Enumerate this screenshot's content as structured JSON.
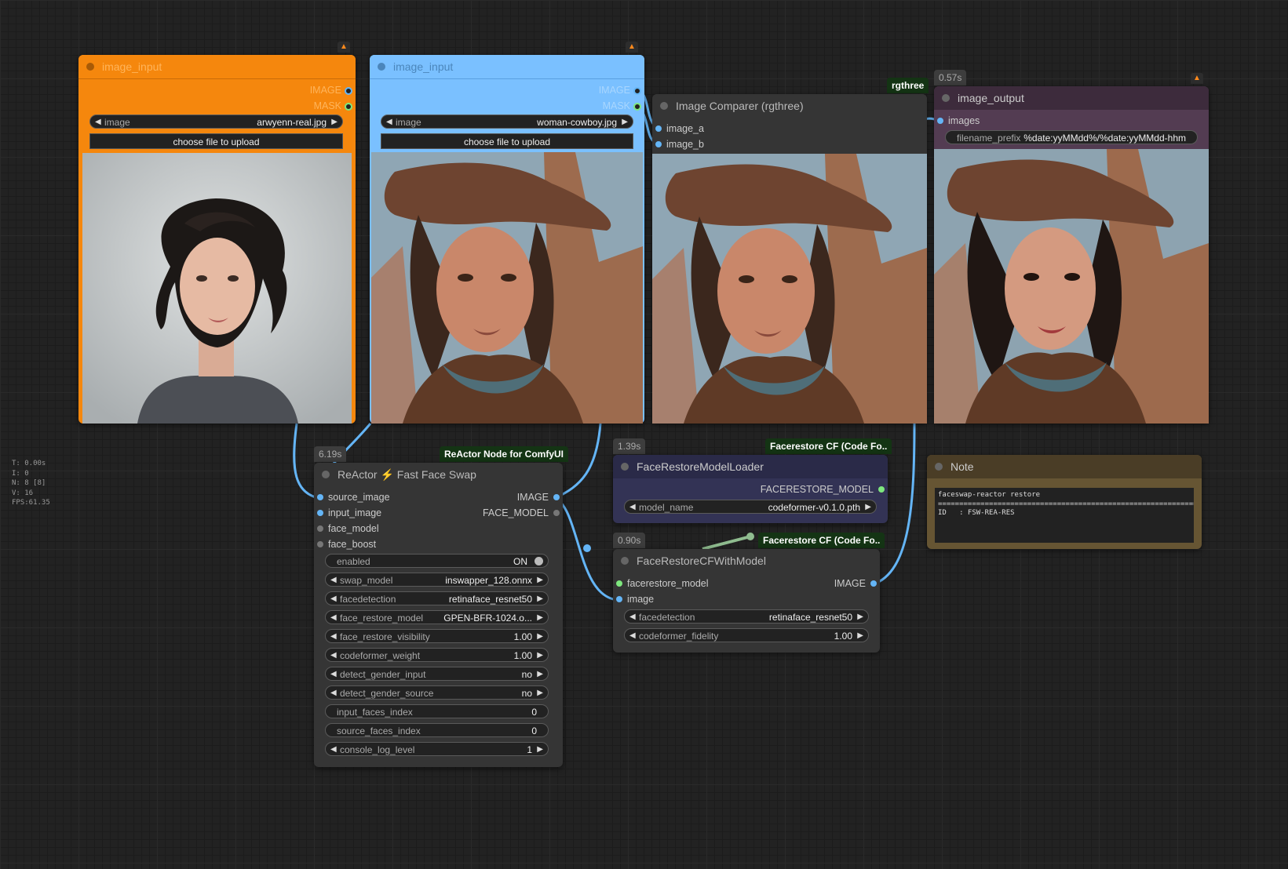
{
  "stats": {
    "lines": [
      "T: 0.00s",
      "I: 0",
      "N: 8 [8]",
      "V: 16",
      "FPS:61.35"
    ]
  },
  "colors": {
    "link_image": "#64b5f6",
    "link_model": "#8fbc8f",
    "canvas_bg": "#222222"
  },
  "nodes": {
    "image_input_1": {
      "title": "image_input",
      "color": "#f5870d",
      "outputs": [
        "IMAGE",
        "MASK"
      ],
      "image_widget": {
        "label": "image",
        "value": "arwyenn-real.jpg"
      },
      "upload_label": "choose file to upload",
      "badge_icon": "fox-icon"
    },
    "image_input_2": {
      "title": "image_input",
      "color": "#7ac0ff",
      "outputs": [
        "IMAGE",
        "MASK"
      ],
      "image_widget": {
        "label": "image",
        "value": "woman-cowboy.jpg"
      },
      "upload_label": "choose file to upload",
      "badge_icon": "fox-icon"
    },
    "image_comparer": {
      "title": "Image Comparer (rgthree)",
      "pack": "rgthree",
      "inputs": [
        "image_a",
        "image_b"
      ]
    },
    "image_output": {
      "title": "image_output",
      "time": "0.57s",
      "inputs": [
        "images"
      ],
      "filename_prefix": {
        "label": "filename_prefix",
        "value": "%date:yyMMdd%/%date:yyMMdd-hhm"
      },
      "badge_icon": "fox-icon"
    },
    "reactor": {
      "title_a": "ReActor",
      "title_b": "Fast Face Swap",
      "time": "6.19s",
      "pack": "ReActor Node for ComfyUI",
      "inputs": [
        "source_image",
        "input_image",
        "face_model",
        "face_boost"
      ],
      "outputs": [
        "IMAGE",
        "FACE_MODEL"
      ],
      "widgets": [
        {
          "label": "enabled",
          "value": "ON"
        },
        {
          "label": "swap_model",
          "value": "inswapper_128.onnx"
        },
        {
          "label": "facedetection",
          "value": "retinaface_resnet50"
        },
        {
          "label": "face_restore_model",
          "value": "GPEN-BFR-1024.o..."
        },
        {
          "label": "face_restore_visibility",
          "value": "1.00"
        },
        {
          "label": "codeformer_weight",
          "value": "1.00"
        },
        {
          "label": "detect_gender_input",
          "value": "no"
        },
        {
          "label": "detect_gender_source",
          "value": "no"
        },
        {
          "label": "input_faces_index",
          "value": "0"
        },
        {
          "label": "source_faces_index",
          "value": "0"
        },
        {
          "label": "console_log_level",
          "value": "1"
        }
      ]
    },
    "model_loader": {
      "title": "FaceRestoreModelLoader",
      "time": "1.39s",
      "pack": "Facerestore CF (Code Fo..",
      "outputs": [
        "FACERESTORE_MODEL"
      ],
      "model_widget": {
        "label": "model_name",
        "value": "codeformer-v0.1.0.pth"
      }
    },
    "cf_with_model": {
      "title": "FaceRestoreCFWithModel",
      "time": "0.90s",
      "pack": "Facerestore CF (Code Fo..",
      "inputs": [
        "facerestore_model",
        "image"
      ],
      "outputs": [
        "IMAGE"
      ],
      "widgets": [
        {
          "label": "facedetection",
          "value": "retinaface_resnet50"
        },
        {
          "label": "codeformer_fidelity",
          "value": "1.00"
        }
      ]
    },
    "note": {
      "title": "Note",
      "text": "faceswap-reactor restore\n================================================================\nID   : FSW-REA-RES"
    }
  }
}
